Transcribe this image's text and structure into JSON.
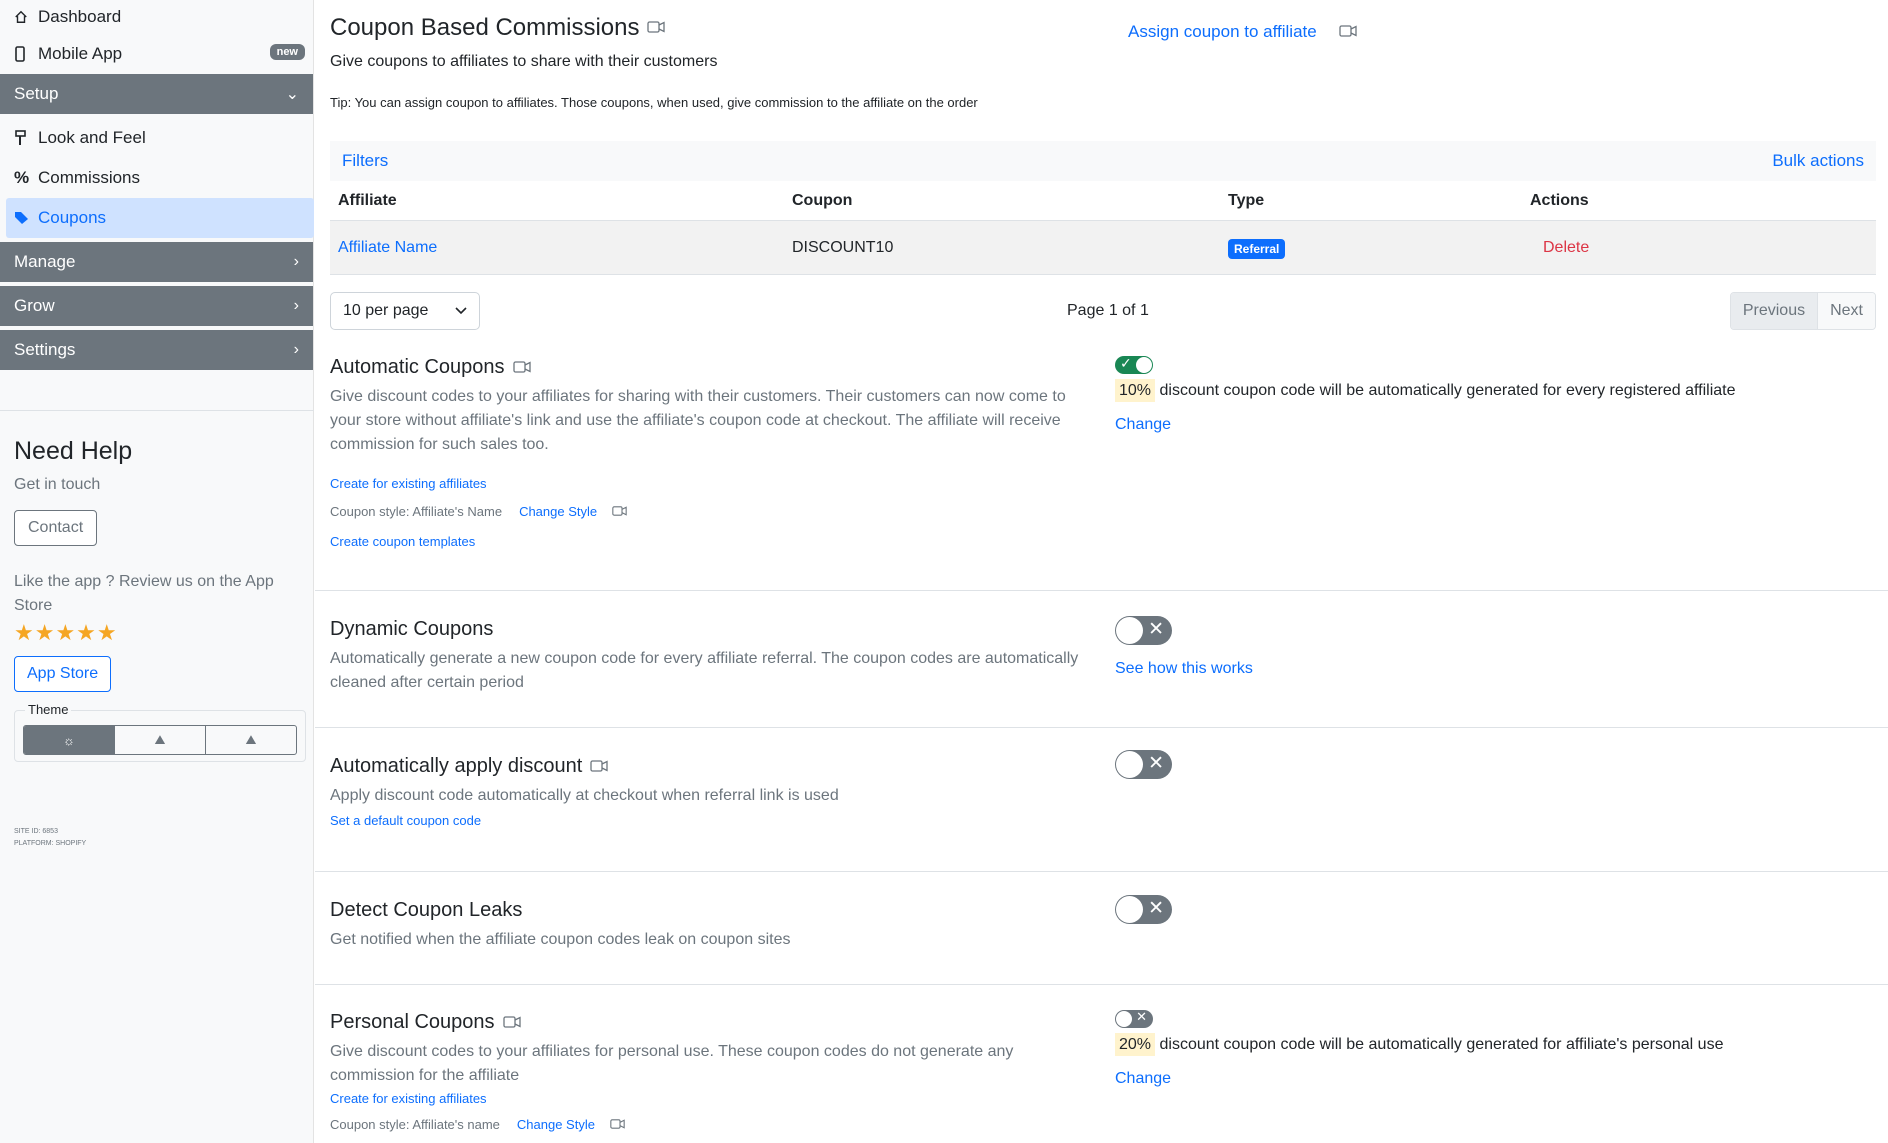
{
  "sidebar": {
    "dashboard": "Dashboard",
    "mobile_app": "Mobile App",
    "mobile_badge": "new",
    "setup": "Setup",
    "look_and_feel": "Look and Feel",
    "commissions": "Commissions",
    "coupons": "Coupons",
    "manage": "Manage",
    "grow": "Grow",
    "settings": "Settings",
    "help_title": "Need Help",
    "help_sub": "Get in touch",
    "contact": "Contact",
    "review_text": "Like the app ? Review us on the App Store",
    "stars": "★★★★★",
    "app_store": "App Store",
    "theme_label": "Theme",
    "site_id": "SITE ID: 6853",
    "platform": "PLATFORM: SHOPIFY"
  },
  "header": {
    "title": "Coupon Based Commissions",
    "subtitle": "Give coupons to affiliates to share with their customers",
    "assign_link": "Assign coupon to affiliate",
    "tip": "Tip: You can assign coupon to affiliates. Those coupons, when used, give commission to the affiliate on the order"
  },
  "table": {
    "filters": "Filters",
    "bulk_actions": "Bulk actions",
    "columns": [
      "Affiliate",
      "Coupon",
      "Type",
      "Actions"
    ],
    "rows": [
      {
        "affiliate": "Affiliate Name",
        "coupon": "DISCOUNT10",
        "type": "Referral",
        "action": "Delete"
      }
    ],
    "per_page": "10 per page",
    "page_info": "Page 1 of 1",
    "previous": "Previous",
    "next": "Next"
  },
  "automatic": {
    "title": "Automatic Coupons",
    "desc": "Give discount codes to your affiliates for sharing with their customers. Their customers can now come to your store without affiliate's link and use the affiliate's coupon code at checkout. The affiliate will receive commission for such sales too.",
    "create_existing": "Create for existing affiliates",
    "coupon_style": "Coupon style: Affiliate's Name",
    "change_style": "Change Style",
    "create_templates": "Create coupon templates",
    "enabled": true,
    "percent": "10%",
    "percent_text": "discount coupon code will be automatically generated for every registered affiliate",
    "change": "Change"
  },
  "dynamic": {
    "title": "Dynamic Coupons",
    "desc": "Automatically generate a new coupon code for every affiliate referral. The coupon codes are automatically cleaned after certain period",
    "see_how": "See how this works",
    "enabled": false
  },
  "auto_apply": {
    "title": "Automatically apply discount",
    "desc": "Apply discount code automatically at checkout when referral link is used",
    "set_default": "Set a default coupon code",
    "enabled": false
  },
  "leaks": {
    "title": "Detect Coupon Leaks",
    "desc": "Get notified when the affiliate coupon codes leak on coupon sites",
    "enabled": false
  },
  "personal": {
    "title": "Personal Coupons",
    "desc": "Give discount codes to your affiliates for personal use. These coupon codes do not generate any commission for the affiliate",
    "create_existing": "Create for existing affiliates",
    "coupon_style": "Coupon style: Affiliate's name",
    "change_style": "Change Style",
    "enabled": false,
    "percent": "20%",
    "percent_text": "discount coupon code will be automatically generated for affiliate's personal use",
    "change": "Change"
  }
}
